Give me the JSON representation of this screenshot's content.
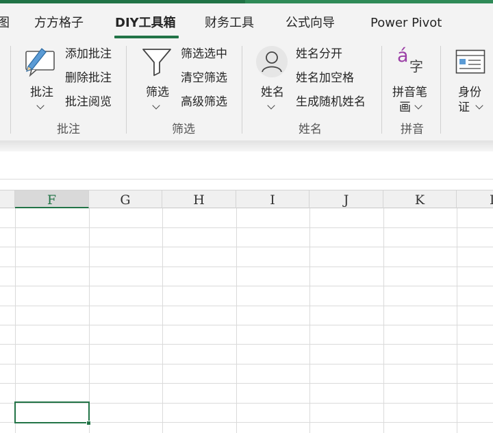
{
  "colors": {
    "title_bar": "#217346",
    "ribbon_bg": "#f3f3f3",
    "selection_accent": "#217346",
    "pinyin_accent": "#9b3fa6"
  },
  "tabs": [
    {
      "label": "图"
    },
    {
      "label": "方方格子"
    },
    {
      "label": "DIY工具箱",
      "active": true
    },
    {
      "label": "财务工具"
    },
    {
      "label": "公式向导"
    },
    {
      "label": "Power Pivot"
    }
  ],
  "ribbon": {
    "comment_group": {
      "label": "批注",
      "big_button": "批注",
      "icon": "pencil-comment-icon",
      "items": [
        "添加批注",
        "删除批注",
        "批注阅览"
      ]
    },
    "filter_group": {
      "label": "筛选",
      "big_button": "筛选",
      "icon": "funnel-icon",
      "items": [
        "筛选选中",
        "清空筛选",
        "高级筛选"
      ]
    },
    "name_group": {
      "label": "姓名",
      "big_button": "姓名",
      "icon": "person-icon",
      "items": [
        "姓名分开",
        "姓名加空格",
        "生成随机姓名"
      ]
    },
    "pinyin_group": {
      "label": "拼音",
      "big_button_line1": "拼音笔",
      "big_button_line2": "画",
      "icon": "pinyin-icon",
      "icon_letter": "á",
      "icon_char": "字"
    },
    "id_group": {
      "big_button_line1": "身份",
      "big_button_line2": "证",
      "icon": "id-card-icon"
    }
  },
  "columns": [
    "F",
    "G",
    "H",
    "I",
    "J",
    "K",
    "L"
  ],
  "selected_column": "F"
}
